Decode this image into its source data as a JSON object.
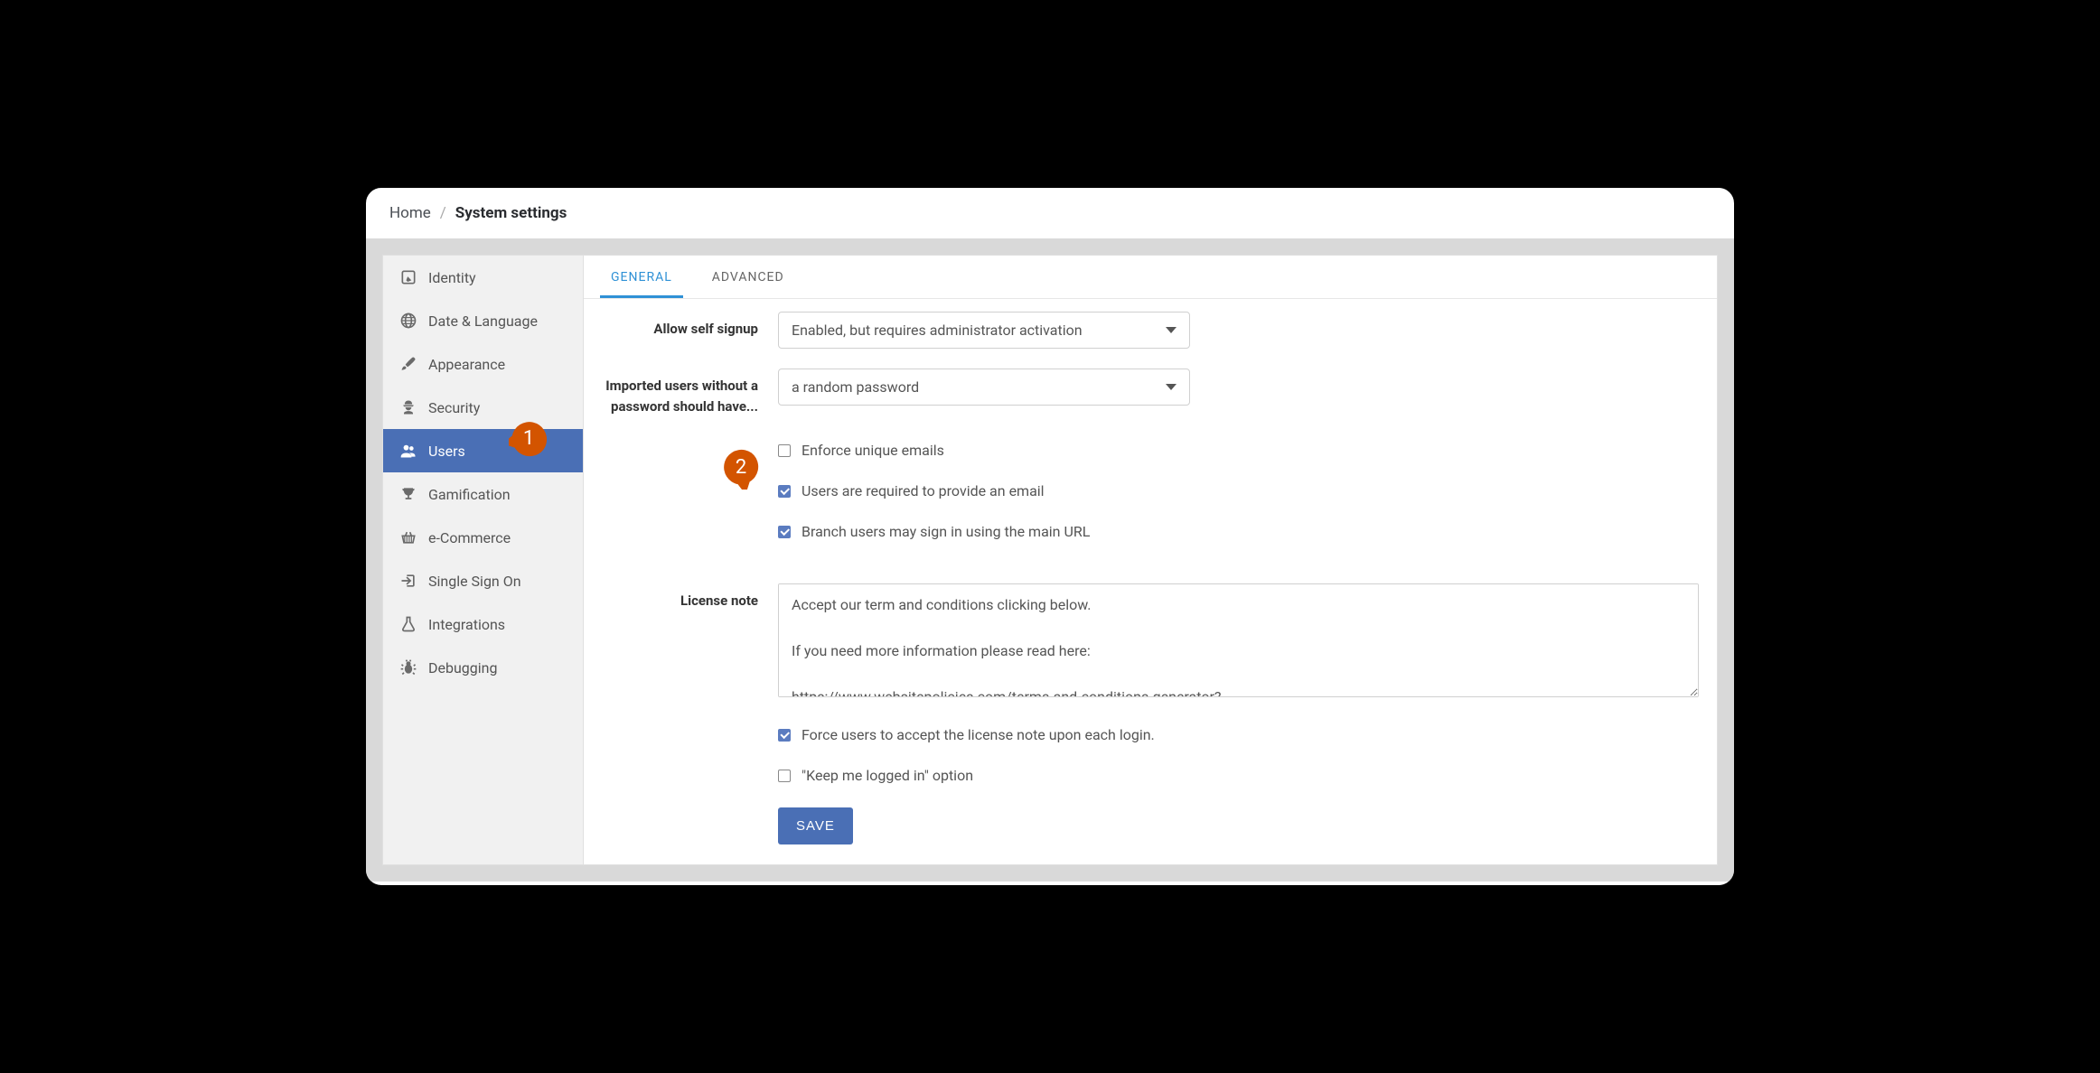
{
  "breadcrumb": {
    "home": "Home",
    "sep": "/",
    "current": "System settings"
  },
  "sidebar": {
    "items": [
      {
        "label": "Identity",
        "icon": "edit-square-icon"
      },
      {
        "label": "Date & Language",
        "icon": "globe-icon"
      },
      {
        "label": "Appearance",
        "icon": "brush-icon"
      },
      {
        "label": "Security",
        "icon": "agent-icon"
      },
      {
        "label": "Users",
        "icon": "users-icon",
        "active": true
      },
      {
        "label": "Gamification",
        "icon": "trophy-icon"
      },
      {
        "label": "e-Commerce",
        "icon": "basket-icon"
      },
      {
        "label": "Single Sign On",
        "icon": "sign-in-icon"
      },
      {
        "label": "Integrations",
        "icon": "flask-icon"
      },
      {
        "label": "Debugging",
        "icon": "bug-icon"
      }
    ]
  },
  "tabs": {
    "general": "GENERAL",
    "advanced": "ADVANCED"
  },
  "form": {
    "allow_signup_label": "Allow self signup",
    "allow_signup_value": "Enabled, but requires administrator activation",
    "imported_pw_label": "Imported users without a password should have...",
    "imported_pw_value": "a random password",
    "checks": {
      "enforce_unique": {
        "label": "Enforce unique emails",
        "checked": false
      },
      "require_email": {
        "label": "Users are required to provide an email",
        "checked": true
      },
      "branch_main_url": {
        "label": "Branch users may sign in using the main URL",
        "checked": true
      },
      "force_license": {
        "label": "Force users to accept the license note upon each login.",
        "checked": true
      },
      "keep_logged_in": {
        "label": "\"Keep me logged in\" option",
        "checked": false
      }
    },
    "license_note_label": "License note",
    "license_note_value": "Accept our term and conditions clicking below.\n\nIf you need more information please read here:\n\nhttps://www.websitepolicies.com/terms-and-conditions-generator?",
    "save_label": "SAVE"
  },
  "markers": {
    "m1": "1",
    "m2": "2"
  },
  "colors": {
    "accent": "#4a6fb5",
    "tab_active": "#2f91d6",
    "marker": "#d35400"
  }
}
